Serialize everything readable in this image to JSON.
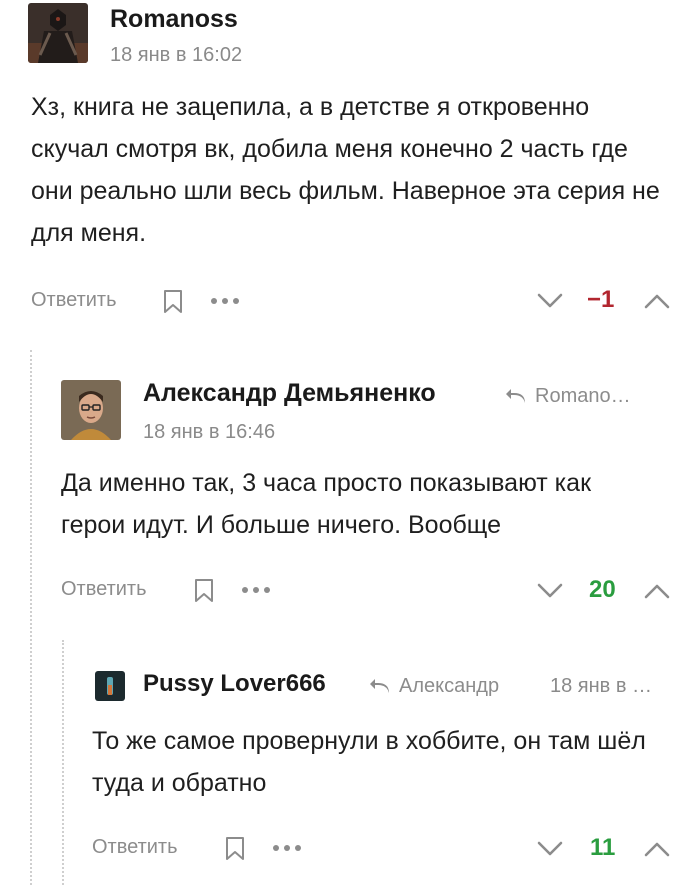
{
  "comments": [
    {
      "author": "Romanoss",
      "time": "18 янв в 16:02",
      "body": "Хз, книга не зацепила, а в детстве я откровенно скучал смотря вк, добила меня конечно 2 часть где они реально шли весь фильм. Наверное эта серия не для меня.",
      "reply_label": "Ответить",
      "rating": "−1",
      "rating_color": "#b2262f",
      "avatar_icon": "dark-armor-avatar"
    },
    {
      "author": "Александр Демьяненко",
      "reply_to": "Romano…",
      "time": "18 янв в 16:46",
      "body": "Да именно так, 3 часа просто показывают как герои идут. И больше ничего. Вообще",
      "reply_label": "Ответить",
      "rating": "20",
      "rating_color": "#2a9d3f",
      "avatar_icon": "man-glasses-avatar"
    },
    {
      "author": "Pussy Lover666",
      "reply_to": "Александр",
      "time": "18 янв в …",
      "body": "То же самое провернули в хоббите, он там шёл туда и обратно",
      "reply_label": "Ответить",
      "rating": "11",
      "rating_color": "#2a9d3f",
      "avatar_icon": "dark-figure-avatar"
    }
  ]
}
